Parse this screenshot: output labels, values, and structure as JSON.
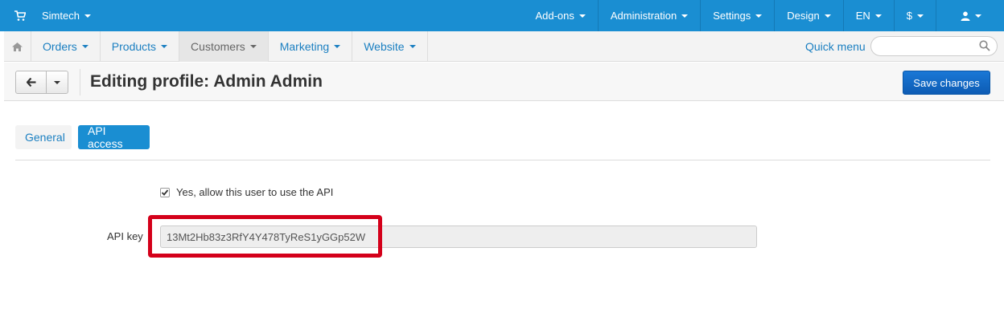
{
  "topbar": {
    "store_name": "Simtech",
    "menu": [
      "Add-ons",
      "Administration",
      "Settings",
      "Design",
      "EN",
      "$"
    ],
    "user_icon": "user-icon",
    "cart_icon": "cart-icon",
    "bg_color": "#1a8ed2"
  },
  "nav": {
    "home_icon": "home-icon",
    "items": [
      "Orders",
      "Products",
      "Customers",
      "Marketing",
      "Website"
    ],
    "active": "Customers",
    "quick_menu": "Quick menu",
    "search_placeholder": ""
  },
  "header": {
    "title": "Editing profile: Admin Admin",
    "back_icon": "arrow-left-icon",
    "save_label": "Save changes"
  },
  "tabs": [
    {
      "label": "General",
      "active": false
    },
    {
      "label": "API access",
      "active": true
    }
  ],
  "form": {
    "allow_api_label": "Yes, allow this user to use the API",
    "allow_api_checked": true,
    "api_key_label": "API key",
    "api_key_value": "13Mt2Hb83z3RfY4Y478TyReS1yGGp52W"
  }
}
